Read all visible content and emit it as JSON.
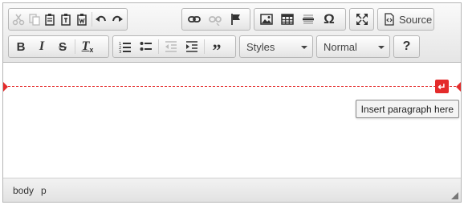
{
  "toolbar": {
    "styles_label": "Styles",
    "format_label": "Normal",
    "source_label": "Source",
    "help_label": "?",
    "icons": [
      "cut-icon",
      "copy-icon",
      "paste-icon",
      "paste-text-icon",
      "paste-word-icon",
      "undo-icon",
      "redo-icon",
      "link-icon",
      "unlink-icon",
      "anchor-icon",
      "image-icon",
      "table-icon",
      "horizontal-rule-icon",
      "special-char-icon",
      "maximize-icon",
      "source-icon",
      "bold-icon",
      "italic-icon",
      "strike-icon",
      "remove-format-icon",
      "numbered-list-icon",
      "bulleted-list-icon",
      "outdent-icon",
      "indent-icon",
      "blockquote-icon"
    ]
  },
  "content": {
    "tooltip_text": "Insert paragraph here",
    "insert_icon": "↵",
    "accent_color": "#e42b2b"
  },
  "statusbar": {
    "path": [
      "body",
      "p"
    ]
  }
}
